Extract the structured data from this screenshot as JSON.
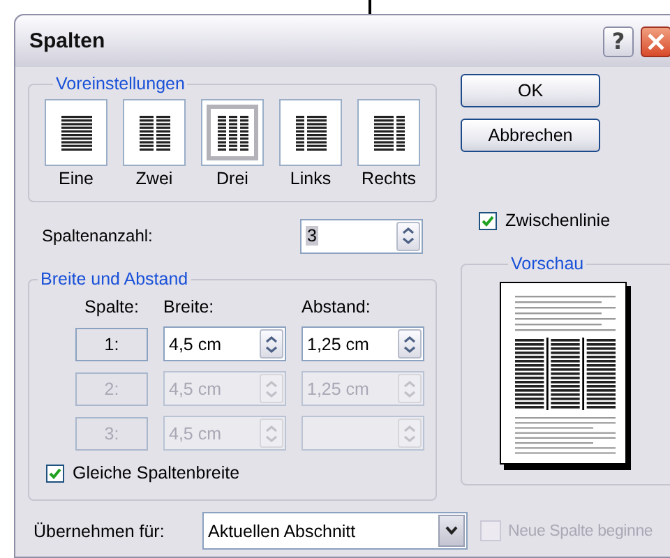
{
  "window": {
    "title": "Spalten",
    "help_button": "?"
  },
  "presets": {
    "title": "Voreinstellungen",
    "items": [
      {
        "label": "Eine",
        "kind": "one",
        "selected": false
      },
      {
        "label": "Zwei",
        "kind": "two",
        "selected": false
      },
      {
        "label": "Drei",
        "kind": "three",
        "selected": true
      },
      {
        "label": "Links",
        "kind": "left",
        "selected": false
      },
      {
        "label": "Rechts",
        "kind": "right",
        "selected": false
      }
    ]
  },
  "buttons": [
    "OK",
    "Abbrechen"
  ],
  "column_count": {
    "label": "Spaltenanzahl:",
    "value": "3"
  },
  "separator_line": {
    "label": "Zwischenlinie",
    "checked": true
  },
  "width_spacing": {
    "title": "Breite und Abstand",
    "headers": [
      "Spalte:",
      "Breite:",
      "Abstand:"
    ],
    "rows": [
      {
        "column": "1:",
        "width": "4,5 cm",
        "spacing": "1,25 cm",
        "disabled": false
      },
      {
        "column": "2:",
        "width": "4,5 cm",
        "spacing": "1,25 cm",
        "disabled": true
      },
      {
        "column": "3:",
        "width": "4,5 cm",
        "disabled": true
      }
    ],
    "equal_width": {
      "label": "Gleiche Spaltenbreite",
      "checked": true
    }
  },
  "preview": {
    "title": "Vorschau"
  },
  "apply_to": {
    "label": "Übernehmen für:",
    "value": "Aktuellen Abschnitt"
  },
  "new_column": {
    "label": "Neue Spalte beginne",
    "checked": false,
    "disabled": true
  }
}
